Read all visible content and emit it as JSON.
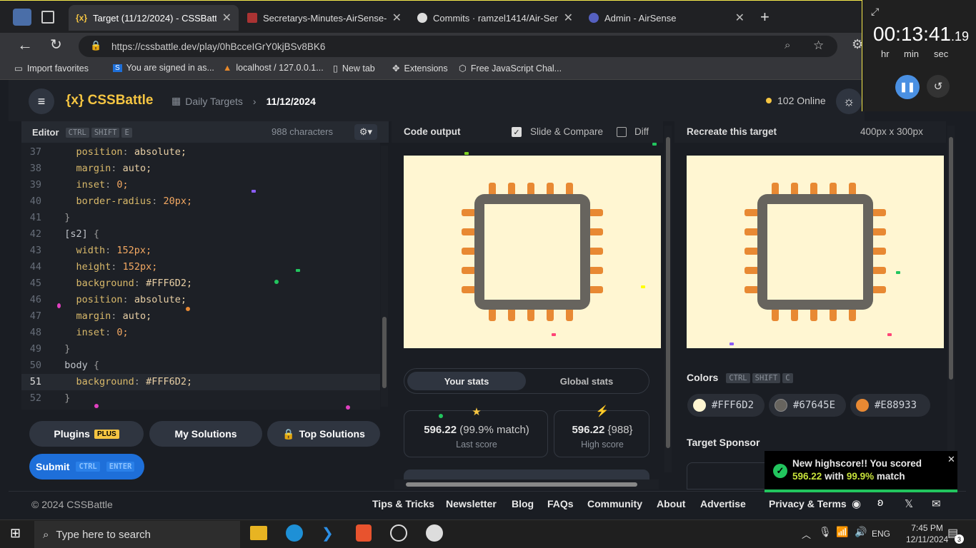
{
  "browser": {
    "tabs": [
      {
        "title": "Target (11/12/2024) - CSSBattle",
        "active": true
      },
      {
        "title": "Secretarys-Minutes-AirSense-Fina"
      },
      {
        "title": "Commits · ramzel1414/Air-Sense"
      },
      {
        "title": "Admin - AirSense"
      }
    ],
    "url": "https://cssbattle.dev/play/0hBcceIGrY0kjBSv8BK6",
    "bookmarks": [
      "Import favorites",
      "You are signed in as...",
      "localhost / 127.0.0.1...",
      "New tab",
      "Extensions",
      "Free JavaScript Chal..."
    ]
  },
  "header": {
    "logo": "{x} CSSBattle",
    "breadcrumb_parent": "Daily Targets",
    "breadcrumb_current": "11/12/2024",
    "online": "102 Online"
  },
  "editor": {
    "title": "Editor",
    "shortcut": [
      "CTRL",
      "SHIFT",
      "E"
    ],
    "chars": "988 characters",
    "lines": [
      {
        "n": "37",
        "prop": "position",
        "val": "absolute;"
      },
      {
        "n": "38",
        "prop": "margin",
        "val": "auto;"
      },
      {
        "n": "39",
        "prop": "inset",
        "val": "0;"
      },
      {
        "n": "40",
        "prop": "border-radius",
        "val": "20px;"
      },
      {
        "n": "41",
        "text": "}"
      },
      {
        "n": "42",
        "sel": "[s2]",
        "brace": "{"
      },
      {
        "n": "43",
        "prop": "width",
        "val": "152px;"
      },
      {
        "n": "44",
        "prop": "height",
        "val": "152px;"
      },
      {
        "n": "45",
        "prop": "background",
        "val": "#FFF6D2;"
      },
      {
        "n": "46",
        "prop": "position",
        "val": "absolute;"
      },
      {
        "n": "47",
        "prop": "margin",
        "val": "auto;"
      },
      {
        "n": "48",
        "prop": "inset",
        "val": "0;"
      },
      {
        "n": "49",
        "text": "}"
      },
      {
        "n": "50",
        "sel": "body",
        "brace": "{"
      },
      {
        "n": "51",
        "prop": "background",
        "val": "#FFF6D2;"
      },
      {
        "n": "52",
        "text": "}"
      }
    ]
  },
  "buttons": {
    "plugins": "Plugins",
    "plus": "PLUS",
    "my_solutions": "My Solutions",
    "top_solutions": "Top Solutions",
    "submit": "Submit",
    "submit_keys": [
      "CTRL",
      "ENTER"
    ]
  },
  "output": {
    "title": "Code output",
    "slide_compare": "Slide & Compare",
    "diff": "Diff",
    "tab_your": "Your stats",
    "tab_global": "Global stats",
    "last_score": "596.22",
    "last_match": "(99.9% match)",
    "last_label": "Last score",
    "high_score": "596.22",
    "high_chars": "{988}",
    "high_label": "High score"
  },
  "target": {
    "title": "Recreate this target",
    "size": "400px x 300px",
    "colors_label": "Colors",
    "colors_keys": [
      "CTRL",
      "SHIFT",
      "C"
    ],
    "colors": [
      "#FFF6D2",
      "#67645E",
      "#E88933"
    ],
    "sponsor": "Target Sponsor"
  },
  "toast": {
    "line1": "New highscore!! You scored",
    "score": "596.22",
    "with": "with",
    "match": "99.9%",
    "tail": "match"
  },
  "footer": {
    "copyright": "© 2024 CSSBattle",
    "links": [
      "Tips & Tricks",
      "Newsletter",
      "Blog",
      "FAQs",
      "Community",
      "About",
      "Advertise",
      "Privacy & Terms"
    ]
  },
  "timer": {
    "time": "00:13:41",
    "frac": ".19",
    "hr": "hr",
    "min": "min",
    "sec": "sec"
  },
  "taskbar": {
    "search": "Type here to search",
    "lang": "ENG",
    "time": "7:45 PM",
    "date": "12/11/2024",
    "notif": "3"
  }
}
